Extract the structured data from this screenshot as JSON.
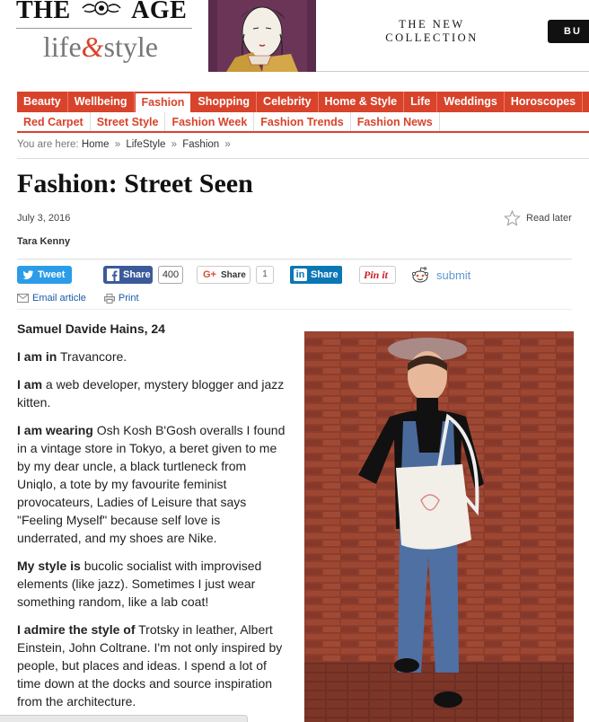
{
  "masthead": {
    "brand_left": "THE",
    "brand_right": "AGE",
    "section_life": "life",
    "section_amp": "&",
    "section_style": "style"
  },
  "ad": {
    "line1": "THE NEW",
    "line2": "COLLECTION",
    "button_label": "BU"
  },
  "nav_main": [
    {
      "label": "Beauty",
      "active": false
    },
    {
      "label": "Wellbeing",
      "active": false
    },
    {
      "label": "Fashion",
      "active": true
    },
    {
      "label": "Shopping",
      "active": false
    },
    {
      "label": "Celebrity",
      "active": false
    },
    {
      "label": "Home & Style",
      "active": false
    },
    {
      "label": "Life",
      "active": false
    },
    {
      "label": "Weddings",
      "active": false
    },
    {
      "label": "Horoscopes",
      "active": false
    },
    {
      "label": "C",
      "active": false
    }
  ],
  "nav_sub": [
    "Red Carpet",
    "Street Style",
    "Fashion Week",
    "Fashion Trends",
    "Fashion News"
  ],
  "breadcrumb": {
    "prefix": "You are here:",
    "items": [
      "Home",
      "LifeStyle",
      "Fashion"
    ],
    "separator": "»"
  },
  "article": {
    "title": "Fashion: Street Seen",
    "date": "July 3, 2016",
    "author": "Tara Kenny",
    "read_later": "Read later",
    "subject": "Samuel Davide Hains, 24",
    "paragraphs": [
      {
        "lead": "I am in",
        "text": " Travancore."
      },
      {
        "lead": "I am",
        "text": " a web developer, mystery blogger and jazz kitten."
      },
      {
        "lead": "I am wearing",
        "text": " Osh Kosh B'Gosh overalls I found in a vintage store in Tokyo, a beret given to me by my dear uncle, a black turtleneck from Uniqlo, a tote by my favourite feminist provocateurs, Ladies of Leisure that says \"Feeling Myself\" because self love is underrated, and my shoes are Nike."
      },
      {
        "lead": "My style is",
        "text": " bucolic socialist with improvised elements (like jazz). Sometimes I just wear something random, like a lab coat!"
      },
      {
        "lead": "I admire the style of",
        "text": " Trotsky in leather, Albert Einstein, John Coltrane. I'm not only inspired by people, but places and ideas. I spend a lot of time down at the docks and source inspiration from the architecture."
      }
    ]
  },
  "share": {
    "tweet": "Tweet",
    "facebook": "Share",
    "facebook_count": "400",
    "gplus": "Share",
    "gplus_count": "1",
    "linkedin_in": "in",
    "linkedin": "Share",
    "pinterest": "Pin it",
    "reddit": "submit"
  },
  "utility": {
    "email": "Email article",
    "print": "Print"
  },
  "colors": {
    "brand_red": "#d8432b",
    "twitter": "#2b9ce8",
    "facebook": "#3b5a99",
    "linkedin": "#0b77b5",
    "link_blue": "#1a5aa8"
  },
  "icons": [
    "star-icon",
    "twitter-bird-icon",
    "facebook-f-icon",
    "gplus-icon",
    "linkedin-icon",
    "reddit-alien-icon",
    "envelope-icon",
    "printer-icon"
  ]
}
